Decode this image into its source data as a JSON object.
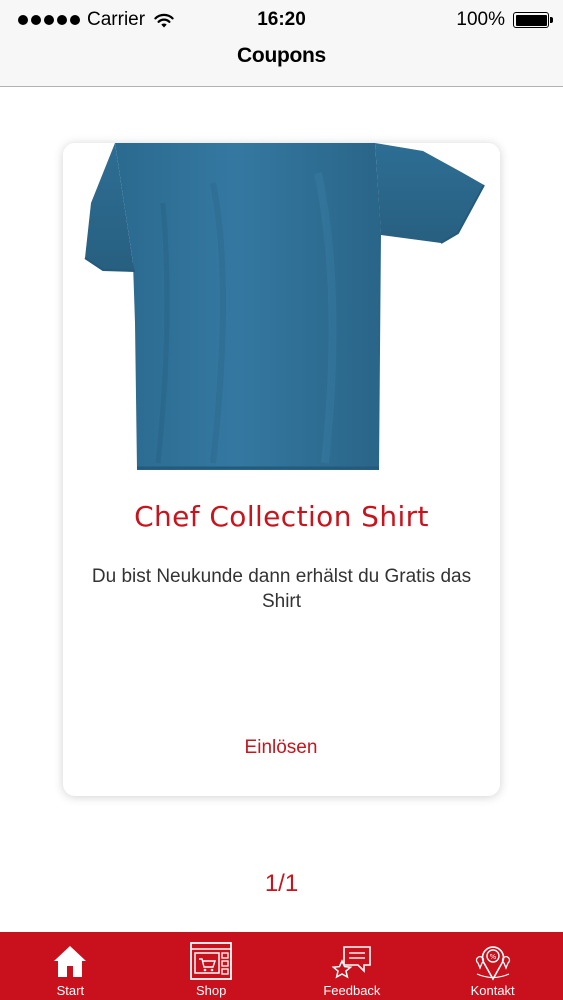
{
  "status_bar": {
    "carrier": "Carrier",
    "time": "16:20",
    "battery": "100%"
  },
  "nav": {
    "title": "Coupons"
  },
  "coupon": {
    "image_icon": "blue-tshirt-image",
    "title": "Chef Collection Shirt",
    "description": "Du bist Neukunde dann erhälst du Gratis das Shirt",
    "redeem_label": "Einlösen"
  },
  "pager": {
    "label": "1/1"
  },
  "tabs": [
    {
      "label": "Start",
      "icon": "home-icon"
    },
    {
      "label": "Shop",
      "icon": "shop-icon"
    },
    {
      "label": "Feedback",
      "icon": "feedback-icon"
    },
    {
      "label": "Kontakt",
      "icon": "location-icon"
    }
  ],
  "colors": {
    "accent": "#c8141c",
    "tab_bar": "#c8111c",
    "shirt": "#2f6f96"
  }
}
